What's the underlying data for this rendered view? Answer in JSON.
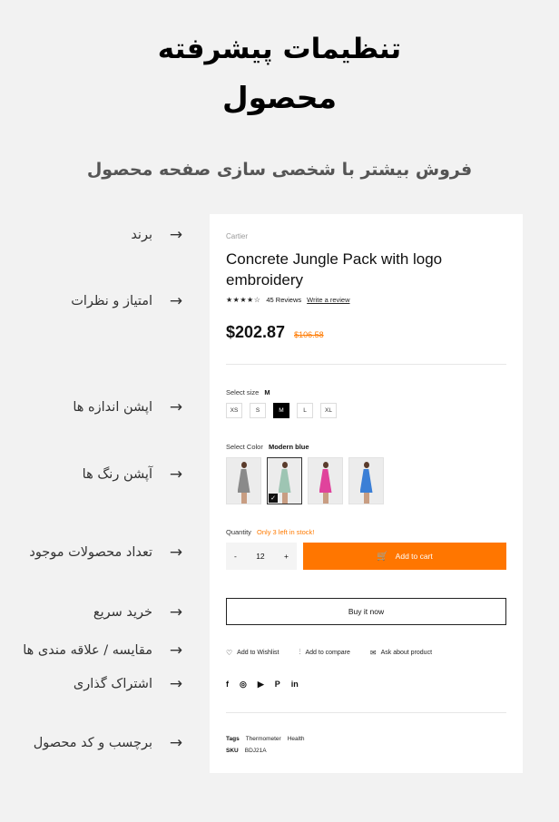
{
  "hero": {
    "title_line1": "تنظیمات پیشرفته",
    "title_line2": "محصول",
    "subtitle": "فروش بیشتر با شخصی سازی صفحه محصول"
  },
  "features": [
    {
      "label": "برند",
      "arrow": "→"
    },
    {
      "label": "امتیاز و نظرات",
      "arrow": "→"
    },
    {
      "label": "اپشن اندازه ها",
      "arrow": "→"
    },
    {
      "label": "آپشن رنگ ها",
      "arrow": "→"
    },
    {
      "label": "تعداد محصولات موجود",
      "arrow": "→"
    },
    {
      "label": "خرید سریع",
      "arrow": "→"
    },
    {
      "label": "مقایسه / علاقه مندی ها",
      "arrow": "→"
    },
    {
      "label": "اشتراک گذاری",
      "arrow": "→"
    },
    {
      "label": "برچسب و کد محصول",
      "arrow": "→"
    }
  ],
  "product": {
    "brand": "Cartier",
    "title": "Concrete Jungle Pack with logo embroidery",
    "stars": "★★★★☆",
    "reviews": "45 Reviews",
    "write_review": "Write a review",
    "price": "$202.87",
    "old_price": "$106.58",
    "size_label": "Select size",
    "size_selected": "M",
    "sizes": [
      "XS",
      "S",
      "M",
      "L",
      "XL"
    ],
    "color_label": "Select Color",
    "color_selected": "Modern blue",
    "swatch_colors": [
      "#8a8a8a",
      "#9ec5b3",
      "#e0439c",
      "#3b7fd6"
    ],
    "quantity_label": "Quantity",
    "stock_note": "Only 3 left in stock!",
    "qty_minus": "-",
    "qty_value": "12",
    "qty_plus": "+",
    "add_to_cart": "Add to cart",
    "buy_now": "Buy it now",
    "wishlist": "Add to Wishlist",
    "compare": "Add to compare",
    "ask": "Ask about product",
    "social": [
      "f",
      "◎",
      "▶",
      "P",
      "in"
    ],
    "tags_label": "Tags",
    "tag1": "Thermometer",
    "tag2": "Health",
    "sku_label": "SKU",
    "sku": "BDJ21A"
  },
  "colors": {
    "accent": "#ff7600",
    "stock": "#ff7a00"
  }
}
